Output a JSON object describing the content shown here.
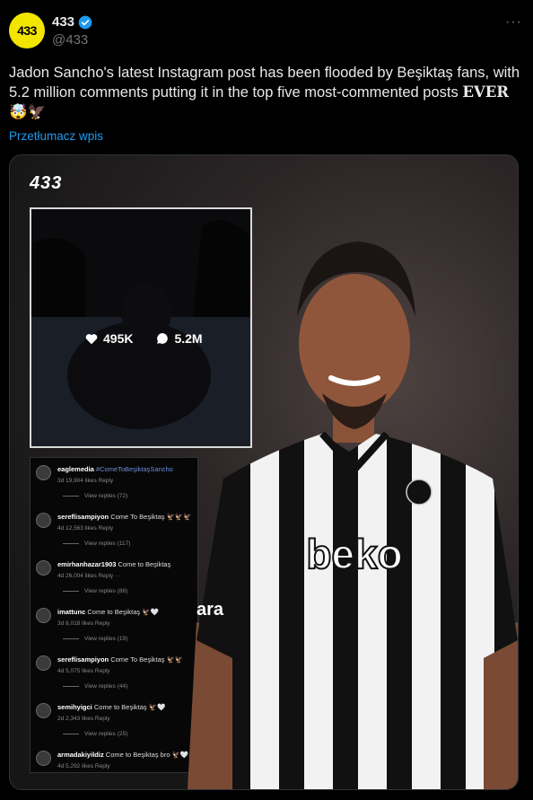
{
  "account": {
    "display_name": "433",
    "handle": "@433",
    "avatar_text": "433",
    "more_label": "···"
  },
  "tweet": {
    "text_main": "Jadon Sancho's latest Instagram post has been flooded by Beşiktaş fans, with 5.2 million comments putting it in the top five most-commented posts ",
    "text_ever": "EVER",
    "text_emoji": " 🤯🦅",
    "translate_label": "Przetłumacz wpis"
  },
  "media": {
    "logo": "433",
    "likes": "495K",
    "comments_count": "5.2M",
    "sponsor": "beko",
    "sleeve_text": "ara",
    "comments": [
      {
        "user": "eaglemedia",
        "text": "#ComeToBeşiktaşSancho",
        "meta": "3d   19,904 likes   Reply",
        "replies": "View replies (72)",
        "tag": true
      },
      {
        "user": "sereflisampiyon",
        "text": "Come To Beşiktaş 🦅🦅🦅",
        "meta": "4d   12,563 likes   Reply",
        "replies": "View replies (117)",
        "tag": false
      },
      {
        "user": "emirhanhazar1903",
        "text": "Come to Beşiktaş",
        "meta": "4d   26,004 likes   Reply   ···",
        "replies": "View replies (86)",
        "tag": false
      },
      {
        "user": "imattunc",
        "text": "Come to Beşiktaş 🦅🤍",
        "meta": "3d   8,018 likes   Reply",
        "replies": "View replies (19)",
        "tag": false
      },
      {
        "user": "sereflisampiyon",
        "text": "Come To Beşiktaş 🦅🦅",
        "meta": "4d   5,075 likes   Reply",
        "replies": "View replies (44)",
        "tag": false
      },
      {
        "user": "semihyigci",
        "text": "Come to Beşiktaş 🦅🤍",
        "meta": "2d   2,343 likes   Reply",
        "replies": "View replies (25)",
        "tag": false
      },
      {
        "user": "armadakiyildiz",
        "text": "Come to Beşiktaş bro 🦅🤍",
        "meta": "4d   5,292 likes   Reply",
        "replies": "",
        "tag": false
      }
    ]
  },
  "colors": {
    "accent": "#1d9bf0",
    "avatar_bg": "#f2e500",
    "background": "#000000"
  }
}
